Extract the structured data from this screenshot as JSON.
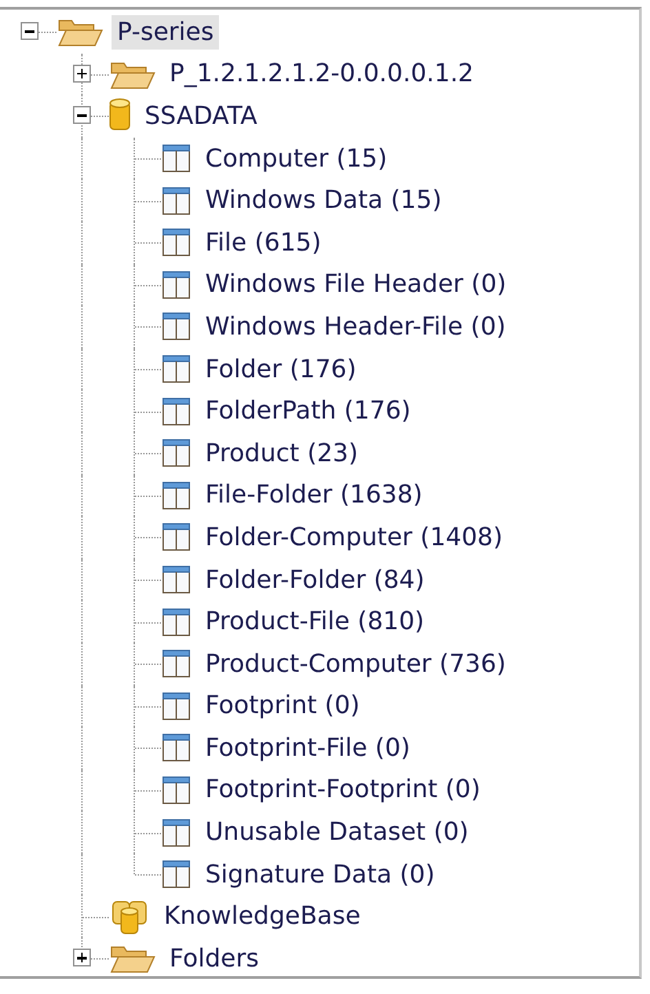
{
  "tree": [
    {
      "label": "P-series",
      "kind": "folder",
      "selected": true,
      "expanded": true,
      "children": [
        {
          "label": "P_1.2.1.2.1.2-0.0.0.0.1.2",
          "kind": "folder",
          "selected": false,
          "expanded": false
        },
        {
          "label": "SSADATA",
          "kind": "database",
          "selected": false,
          "expanded": true,
          "children": [
            {
              "label": "Computer (15)",
              "kind": "table",
              "selected": false
            },
            {
              "label": "Windows Data (15)",
              "kind": "table",
              "selected": false
            },
            {
              "label": "File (615)",
              "kind": "table",
              "selected": false
            },
            {
              "label": "Windows File Header (0)",
              "kind": "table",
              "selected": false
            },
            {
              "label": "Windows Header-File (0)",
              "kind": "table",
              "selected": false
            },
            {
              "label": "Folder (176)",
              "kind": "table",
              "selected": false
            },
            {
              "label": "FolderPath (176)",
              "kind": "table",
              "selected": false
            },
            {
              "label": "Product (23)",
              "kind": "table",
              "selected": false
            },
            {
              "label": "File-Folder (1638)",
              "kind": "table",
              "selected": false
            },
            {
              "label": "Folder-Computer (1408)",
              "kind": "table",
              "selected": false
            },
            {
              "label": "Folder-Folder (84)",
              "kind": "table",
              "selected": false
            },
            {
              "label": "Product-File (810)",
              "kind": "table",
              "selected": false
            },
            {
              "label": "Product-Computer (736)",
              "kind": "table",
              "selected": false
            },
            {
              "label": "Footprint (0)",
              "kind": "table",
              "selected": false
            },
            {
              "label": "Footprint-File (0)",
              "kind": "table",
              "selected": false
            },
            {
              "label": "Footprint-Footprint (0)",
              "kind": "table",
              "selected": false
            },
            {
              "label": "Unusable Dataset (0)",
              "kind": "table",
              "selected": false
            },
            {
              "label": "Signature Data (0)",
              "kind": "table",
              "selected": false
            }
          ]
        },
        {
          "label": "KnowledgeBase",
          "kind": "databases",
          "selected": false
        },
        {
          "label": "Folders",
          "kind": "folder",
          "selected": false,
          "expanded": false
        }
      ]
    }
  ]
}
